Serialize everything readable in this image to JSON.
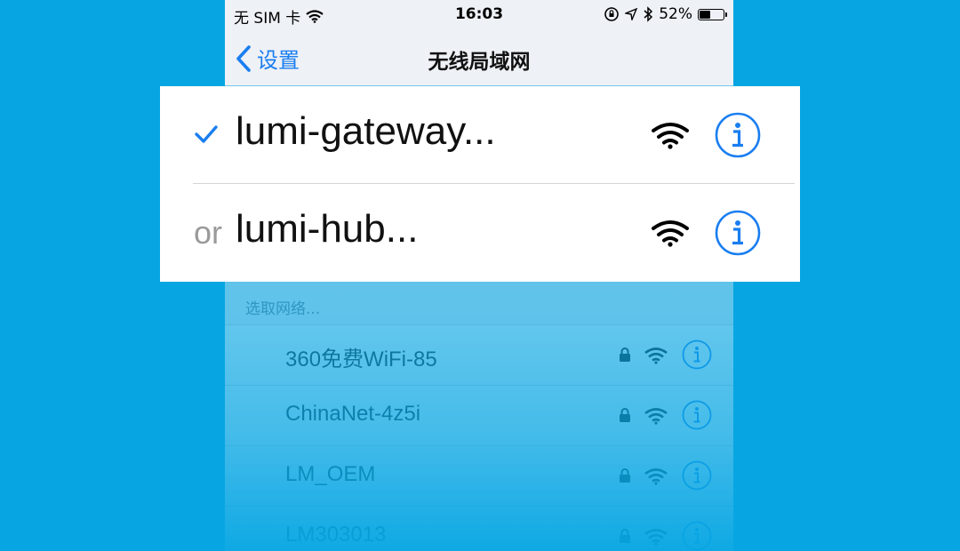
{
  "status_bar": {
    "carrier": "无 SIM 卡",
    "time": "16:03",
    "battery": "52%",
    "battery_level": 0.52
  },
  "nav": {
    "back_label": "设置",
    "title": "无线局域网"
  },
  "highlight": {
    "rows": [
      {
        "prefix": "",
        "ssid": "lumi-gateway...",
        "selected": true
      },
      {
        "prefix": "or",
        "ssid": "lumi-hub...",
        "selected": false
      }
    ]
  },
  "network_list": {
    "header": "选取网络...",
    "networks": [
      {
        "name": "360免费WiFi-85",
        "locked": true
      },
      {
        "name": "ChinaNet-4z5i",
        "locked": true
      },
      {
        "name": "LM_OEM",
        "locked": true
      },
      {
        "name": "LM303013",
        "locked": true
      }
    ]
  },
  "colors": {
    "background": "#07a6e3",
    "accent": "#1a7ef0"
  }
}
